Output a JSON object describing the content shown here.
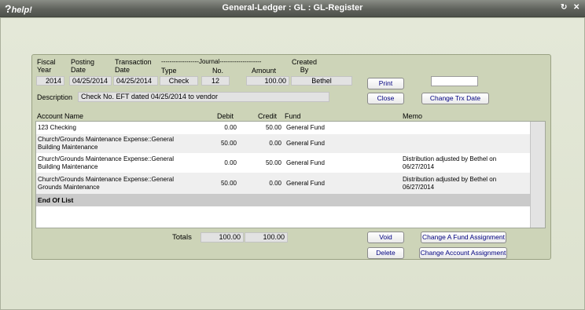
{
  "titlebar": {
    "help": "help!",
    "help_glyph": "?",
    "title": "General-Ledger : GL : GL-Register",
    "refresh_glyph": "↻",
    "close_glyph": "✕"
  },
  "header": {
    "fiscal_year_l1": "Fiscal",
    "fiscal_year_l2": "Year",
    "posting_date_l1": "Posting",
    "posting_date_l2": "Date",
    "trx_date_l1": "Transaction",
    "trx_date_l2": "Date",
    "journal_group": "------------------Journal--------------------",
    "type_label": "Type",
    "no_label": "No.",
    "amount_label": "Amount",
    "created_l1": "Created",
    "created_l2": "By",
    "fiscal_year": "2014",
    "posting_date": "04/25/2014",
    "trx_date": "04/25/2014",
    "type": "Check",
    "no": "12",
    "amount": "100.00",
    "created_by": "Bethel",
    "description_label": "Description",
    "description": "Check No. EFT dated 04/25/2014 to vendor"
  },
  "buttons": {
    "print": "Print",
    "close": "Close",
    "change_trx_date": "Change Trx Date",
    "void": "Void",
    "delete": "Delete",
    "change_fund": "Change A Fund Assignment",
    "change_account": "Change Account Assignment"
  },
  "columns": {
    "account": "Account Name",
    "debit": "Debit",
    "credit": "Credit",
    "fund": "Fund",
    "memo": "Memo"
  },
  "rows": [
    {
      "account_l1": "123 Checking",
      "account_l2": "",
      "debit": "0.00",
      "credit": "50.00",
      "fund": "General Fund",
      "memo_l1": "",
      "memo_l2": ""
    },
    {
      "account_l1": "Church/Grounds Maintenance Expense::General",
      "account_l2": "Building Maintenance",
      "debit": "50.00",
      "credit": "0.00",
      "fund": "General Fund",
      "memo_l1": "",
      "memo_l2": ""
    },
    {
      "account_l1": "Church/Grounds Maintenance Expense::General",
      "account_l2": "Building Maintenance",
      "debit": "0.00",
      "credit": "50.00",
      "fund": "General Fund",
      "memo_l1": "Distribution adjusted by Bethel on",
      "memo_l2": "06/27/2014"
    },
    {
      "account_l1": "Church/Grounds Maintenance Expense::General",
      "account_l2": "Grounds Maintenance",
      "debit": "50.00",
      "credit": "0.00",
      "fund": "General Fund",
      "memo_l1": "Distribution adjusted by Bethel on",
      "memo_l2": "06/27/2014"
    }
  ],
  "end_of_list": "End Of List",
  "totals": {
    "label": "Totals",
    "debit": "100.00",
    "credit": "100.00"
  }
}
